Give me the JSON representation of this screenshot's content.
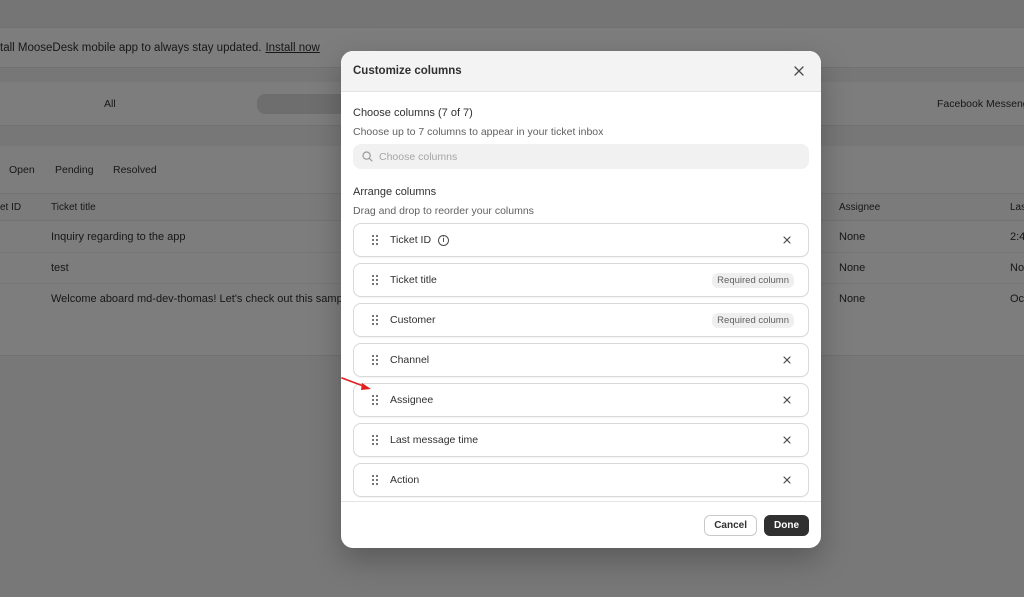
{
  "background": {
    "banner_text": "tall MooseDesk mobile app to always stay updated.",
    "banner_link": "Install now",
    "channels": {
      "all": "All",
      "facebook": "Facebook Messeng"
    },
    "status_tabs": [
      "Open",
      "Pending",
      "Resolved"
    ],
    "table_headers": {
      "ticket_id": "et ID",
      "ticket_title": "Ticket title",
      "assignee": "Assignee",
      "last": "Las"
    },
    "rows": [
      {
        "title": "Inquiry regarding to the app",
        "assignee": "None",
        "last": "2:4"
      },
      {
        "title": "test",
        "assignee": "None",
        "last": "No"
      },
      {
        "title": "Welcome aboard md-dev-thomas! Let's check out this sampl",
        "assignee": "None",
        "last": "Oc"
      }
    ]
  },
  "modal": {
    "title": "Customize columns",
    "choose": {
      "title": "Choose columns (7 of 7)",
      "subtitle": "Choose up to 7 columns to appear in your ticket inbox",
      "placeholder": "Choose columns"
    },
    "arrange": {
      "title": "Arrange columns",
      "subtitle": "Drag and drop to reorder your columns"
    },
    "columns": [
      {
        "label": "Ticket ID",
        "info": "i"
      },
      {
        "label": "Ticket title",
        "badge": "Required column"
      },
      {
        "label": "Customer",
        "badge": "Required column"
      },
      {
        "label": "Channel"
      },
      {
        "label": "Assignee"
      },
      {
        "label": "Last message time"
      },
      {
        "label": "Action"
      }
    ],
    "buttons": {
      "cancel": "Cancel",
      "done": "Done"
    }
  },
  "colors": {
    "overlay": "#000000",
    "primary_button": "#303030",
    "annotation_arrow": "#e02020"
  }
}
